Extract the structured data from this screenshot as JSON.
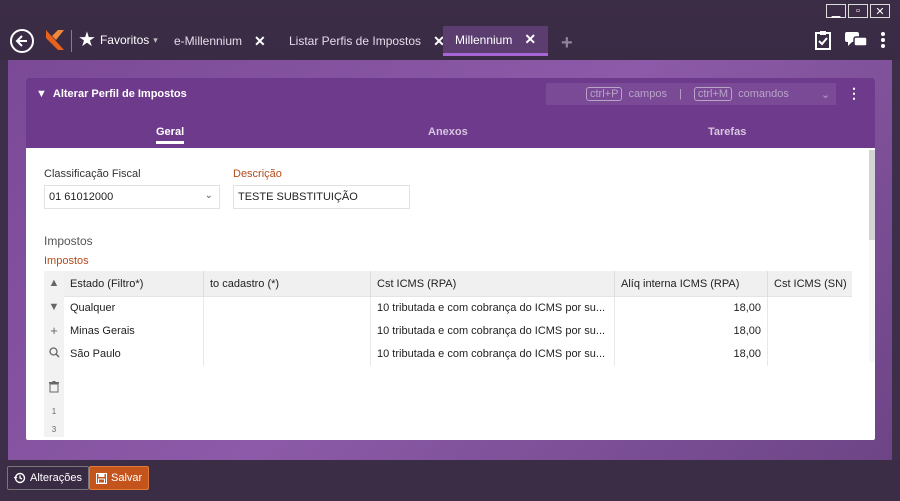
{
  "titlebar": {
    "favorites_label": "Favoritos",
    "tabs": [
      {
        "label": "e-Millennium"
      },
      {
        "label": "Listar Perfis de Impostos"
      },
      {
        "label": "Millennium"
      }
    ],
    "accent_color": "#a866d4"
  },
  "panel": {
    "title": "Alterar Perfil de Impostos",
    "shortcut_campos_key": "ctrl+P",
    "shortcut_campos_label": "campos",
    "shortcut_sep": "|",
    "shortcut_comandos_key": "ctrl+M",
    "shortcut_comandos_label": "comandos",
    "tabs": [
      {
        "label": "Geral"
      },
      {
        "label": "Anexos"
      },
      {
        "label": "Tarefas"
      }
    ]
  },
  "form": {
    "classificacao_label": "Classificação Fiscal",
    "classificacao_value": "01 61012000",
    "descricao_label": "Descrição",
    "descricao_value": "TESTE SUBSTITUIÇÃO"
  },
  "impostos": {
    "section_title": "Impostos",
    "grid_title": "Impostos",
    "columns": [
      "Estado (Filtro*)",
      "to cadastro (*)",
      "Cst ICMS (RPA)",
      "Alíq interna ICMS (RPA)",
      "Cst ICMS (SN)"
    ],
    "rows": [
      {
        "estado": "Qualquer",
        "cadastro": "",
        "cst_rpa": "10 tributada e com cobrança do ICMS por su...",
        "aliq": "18,00",
        "cst_sn": ""
      },
      {
        "estado": "Minas Gerais",
        "cadastro": "",
        "cst_rpa": "10 tributada e com cobrança do ICMS por su...",
        "aliq": "18,00",
        "cst_sn": ""
      },
      {
        "estado": "São Paulo",
        "cadastro": "",
        "cst_rpa": "10 tributada e com cobrança do ICMS por su...",
        "aliq": "18,00",
        "cst_sn": ""
      }
    ],
    "gutter_numbers": [
      "1",
      "3"
    ]
  },
  "footer": {
    "alteracoes_label": "Alterações",
    "salvar_label": "Salvar",
    "save_color": "#c4541b"
  }
}
